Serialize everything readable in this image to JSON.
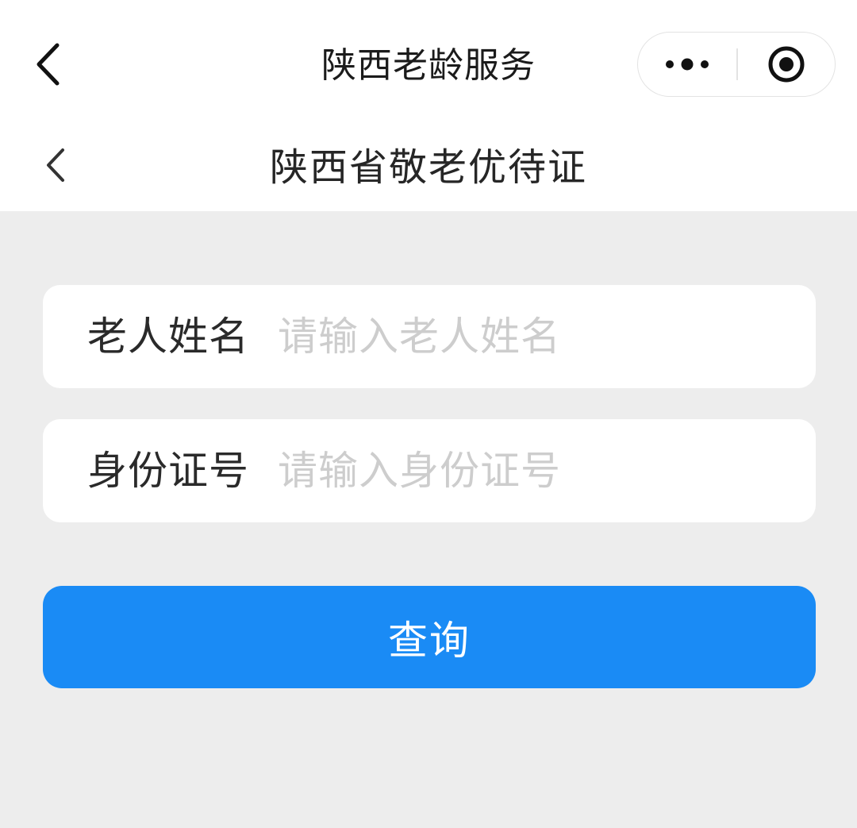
{
  "mini_program_bar": {
    "title": "陕西老龄服务",
    "back_icon": "chevron-left-icon",
    "more_icon": "more-dots-icon",
    "close_icon": "target-close-icon"
  },
  "page_header": {
    "title": "陕西省敬老优待证",
    "back_icon": "chevron-left-icon"
  },
  "form": {
    "name_field": {
      "label": "老人姓名",
      "placeholder": "请输入老人姓名",
      "value": ""
    },
    "id_field": {
      "label": "身份证号",
      "placeholder": "请输入身份证号",
      "value": ""
    },
    "submit_label": "查询"
  },
  "colors": {
    "background": "#ededed",
    "header_background": "#ffffff",
    "primary_button": "#1a8bf5",
    "placeholder": "#cdcdcd",
    "text": "#2a2a2a"
  }
}
